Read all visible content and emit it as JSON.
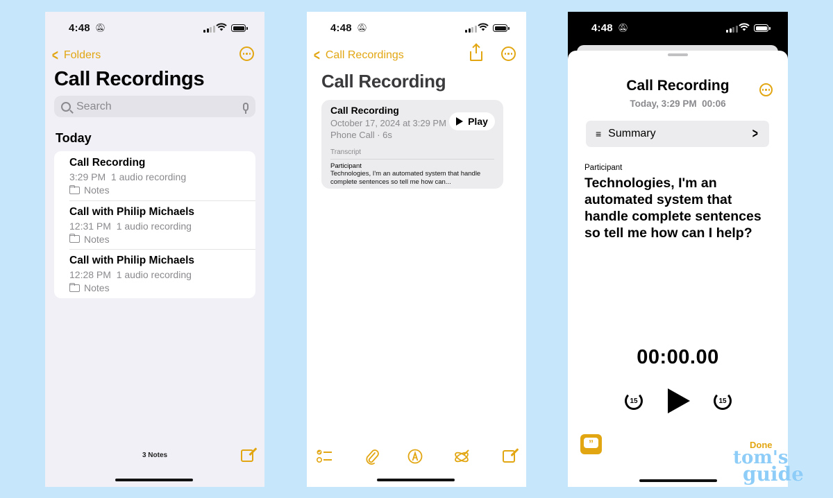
{
  "colors": {
    "accent": "#e2a612",
    "page_background": "#c6e6fb",
    "list_background": "#f1f0f6",
    "secondary_text": "#8a8a8e"
  },
  "status_bar": {
    "time": "4:48",
    "silent_icon": "bell-slash-icon",
    "signal_icon": "cellular-signal-icon",
    "wifi_icon": "wifi-icon",
    "battery_icon": "battery-icon"
  },
  "screen1": {
    "back_label": "Folders",
    "title": "Call Recordings",
    "search_placeholder": "Search",
    "section_header": "Today",
    "notes": [
      {
        "title": "Call Recording",
        "time": "3:29 PM",
        "detail": "1 audio recording",
        "folder": "Notes"
      },
      {
        "title": "Call with Philip Michaels",
        "time": "12:31 PM",
        "detail": "1 audio recording",
        "folder": "Notes"
      },
      {
        "title": "Call with Philip Michaels",
        "time": "12:28 PM",
        "detail": "1 audio recording",
        "folder": "Notes"
      }
    ],
    "notes_count": "3 Notes"
  },
  "screen2": {
    "back_label": "Call Recordings",
    "title": "Call Recording",
    "card": {
      "title": "Call Recording",
      "date": "October 17, 2024 at 3:29 PM",
      "type": "Phone Call · 6s",
      "play_label": "Play",
      "transcript_label": "Transcript",
      "participant": "Participant",
      "text": "Technologies, I'm an automated system that handle complete sentences so tell me how can..."
    },
    "toolbar": [
      "checklist-icon",
      "paperclip-icon",
      "markup-pen-icon",
      "writing-tools-icon",
      "compose-icon"
    ]
  },
  "screen3": {
    "title": "Call Recording",
    "subtitle": "Today, 3:29 PM  00:06",
    "summary_label": "Summary",
    "participant": "Participant",
    "transcript": "Technologies, I'm an automated system that handle complete sentences so tell me how can I help?",
    "timer": "00:00.00",
    "skip_back_label": "15",
    "skip_forward_label": "15",
    "done_label": "Done"
  },
  "watermark": {
    "line1": "tom's",
    "line2": "guide"
  }
}
